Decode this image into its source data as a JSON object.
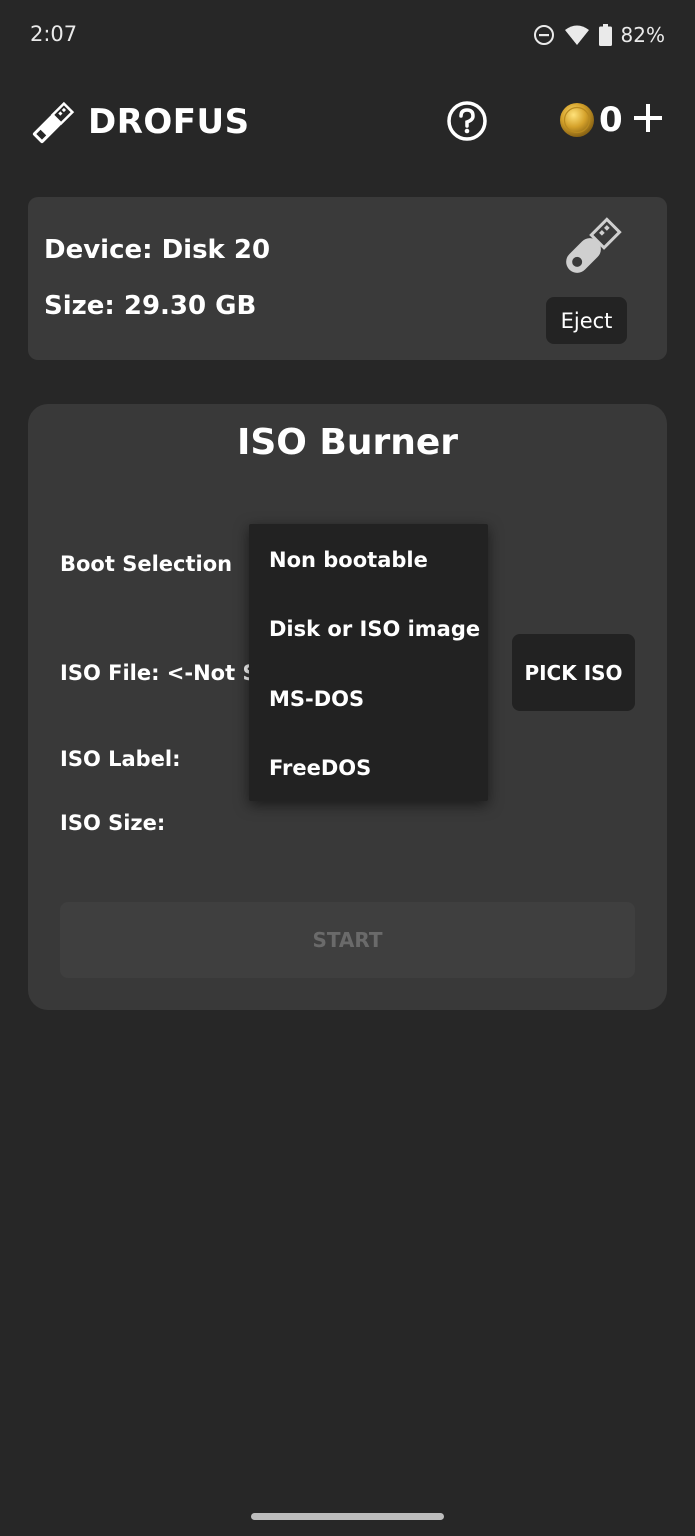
{
  "status_bar": {
    "time": "2:07",
    "battery_percent": "82%",
    "icons": [
      "do-not-disturb-icon",
      "wifi-icon",
      "battery-icon"
    ]
  },
  "app_bar": {
    "title": "DROFUS",
    "coin_count": "0",
    "icons": [
      "usb-drive-logo-icon",
      "help-icon",
      "coin-icon",
      "plus-icon"
    ]
  },
  "device": {
    "device_line": "Device: Disk 20",
    "size_line": "Size: 29.30 GB",
    "eject_label": "Eject"
  },
  "burner": {
    "title": "ISO Burner",
    "boot_selection_label": "Boot Selection",
    "iso_file_label": "ISO File:  <-Not S",
    "iso_label_label": "ISO Label:",
    "iso_size_label": "ISO Size:",
    "pick_iso_label": "PICK ISO",
    "start_label": "START"
  },
  "dropdown": {
    "options": [
      "Non bootable",
      "Disk or ISO image",
      "MS-DOS",
      "FreeDOS"
    ]
  },
  "colors": {
    "background": "#272727",
    "card": "#3a3a3a",
    "button_dark": "#222222",
    "text": "#ffffff",
    "disabled_text": "#6a6a6a",
    "coin_gold": "#d4a12a"
  }
}
